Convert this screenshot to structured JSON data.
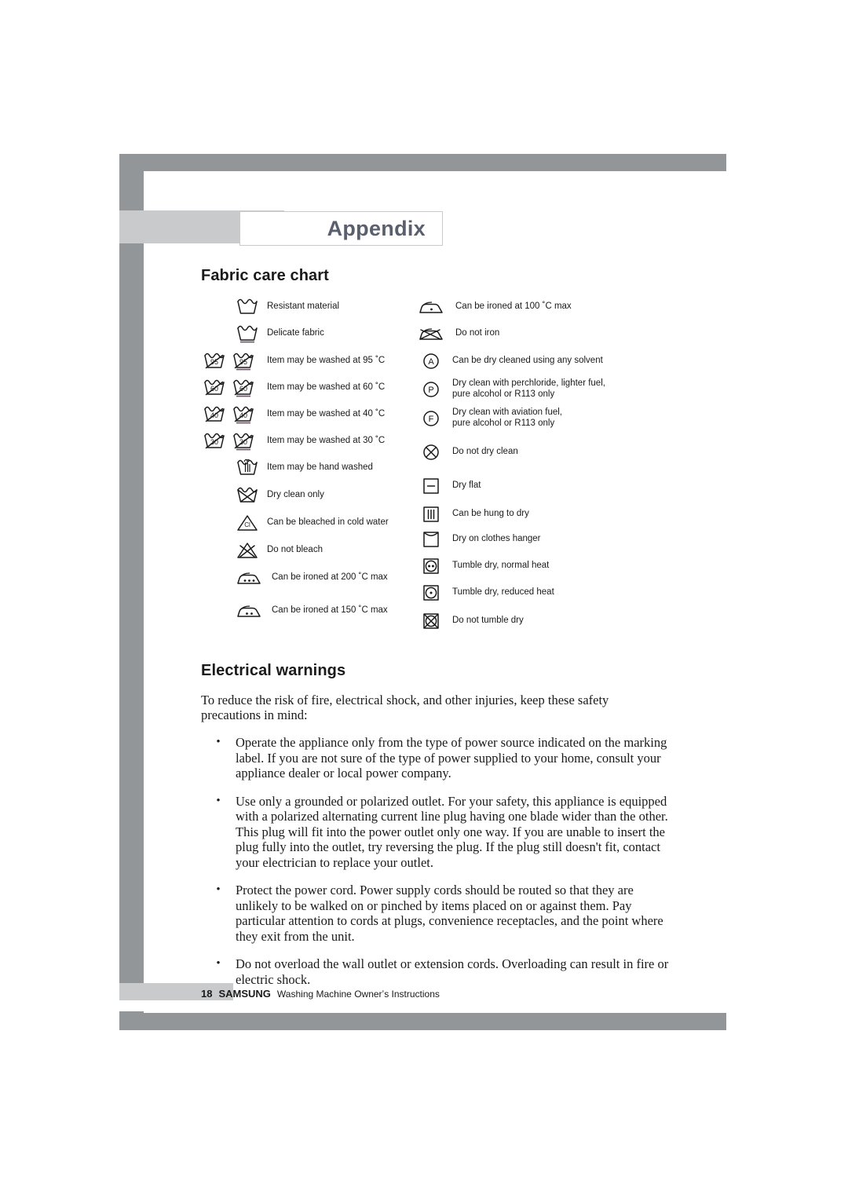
{
  "page": {
    "appendix_title": "Appendix",
    "fabric_chart_heading": "Fabric care chart",
    "electrical_heading": "Electrical warnings"
  },
  "fabric_chart": {
    "left_column": [
      {
        "icon": "wash-tub-icon",
        "label": "Resistant material"
      },
      {
        "icon": "wash-tub-underline-icon",
        "label": "Delicate fabric"
      },
      {
        "icon": "wash-tub-95-pair-icon",
        "label": "Item may be washed at 95 ˚C"
      },
      {
        "icon": "wash-tub-60-pair-icon",
        "label": "Item may be washed at 60 ˚C"
      },
      {
        "icon": "wash-tub-40-pair-icon",
        "label": "Item may be washed at 40 ˚C"
      },
      {
        "icon": "wash-tub-30-pair-icon",
        "label": "Item may be washed at 30 ˚C"
      },
      {
        "icon": "hand-wash-icon",
        "label": "Item may be hand washed"
      },
      {
        "icon": "do-not-wash-icon",
        "label": "Dry clean only"
      },
      {
        "icon": "bleach-cold-triangle-icon",
        "label": "Can be bleached in cold water"
      },
      {
        "icon": "do-not-bleach-icon",
        "label": "Do not bleach"
      },
      {
        "icon": "iron-three-dots-icon",
        "label": "Can be ironed at 200 ˚C max"
      },
      {
        "icon": "iron-two-dots-icon",
        "label": "Can be ironed at 150 ˚C max"
      }
    ],
    "right_column": [
      {
        "icon": "iron-one-dot-icon",
        "label": "Can be ironed at 100 ˚C  max"
      },
      {
        "icon": "do-not-iron-icon",
        "label": "Do not iron"
      },
      {
        "icon": "dryclean-a-icon",
        "label": "Can be dry cleaned using any solvent"
      },
      {
        "icon": "dryclean-p-icon",
        "label": "Dry clean with perchloride, lighter fuel,\npure alcohol or R113 only"
      },
      {
        "icon": "dryclean-f-icon",
        "label": "Dry clean with aviation fuel,\npure alcohol or R113 only"
      },
      {
        "icon": "do-not-dryclean-icon",
        "label": "Do not dry clean"
      },
      {
        "icon": "dry-flat-icon",
        "label": "Dry flat"
      },
      {
        "icon": "hang-to-dry-icon",
        "label": "Can be hung to dry"
      },
      {
        "icon": "drip-dry-hanger-icon",
        "label": "Dry on clothes hanger"
      },
      {
        "icon": "tumble-dry-normal-icon",
        "label": " Tumble dry, normal heat"
      },
      {
        "icon": "tumble-dry-reduced-icon",
        "label": "Tumble dry, reduced heat"
      },
      {
        "icon": "do-not-tumble-dry-icon",
        "label": "Do not tumble dry"
      }
    ],
    "tub_numbers": {
      "t95": "95",
      "t60": "60",
      "t40": "40",
      "t30": "30"
    },
    "dryclean_letters": {
      "a": "A",
      "p": "P",
      "f": "F"
    },
    "bleach_symbol_text": "Cl"
  },
  "warnings": {
    "intro": "To reduce the risk of fire, electrical shock, and other injuries, keep these safety precautions in mind:",
    "bullet_glyph": "•",
    "items": [
      "Operate the appliance only from the type of power source indicated on the marking label.  If you are not sure of the type of power supplied to your home, consult your appliance dealer or local power company.",
      "Use only a grounded or polarized outlet.  For your safety, this appliance is equipped with a polarized alternating current line plug having one blade wider than the other.  This plug will fit into the power outlet only one way.  If you are unable to insert the plug fully into the outlet, try reversing the plug.  If the plug still doesn't fit, contact your electrician to replace your outlet.",
      "Protect the power cord. Power supply cords should be routed so that they are unlikely to be walked on or pinched by items placed on or against them.  Pay particular attention to cords at plugs, convenience receptacles, and the point where they exit from the unit.",
      "Do not overload the wall outlet or extension cords.  Overloading can result in fire or electric shock."
    ]
  },
  "footer": {
    "page_number": "18",
    "brand": "SAMSUNG",
    "title": "Washing Machine Ownerʼs Instructions"
  },
  "colors": {
    "frame_dark": "#939699",
    "frame_light": "#c9cacc",
    "title_text": "#5a5f6e",
    "body_text": "#1a1a1a"
  }
}
